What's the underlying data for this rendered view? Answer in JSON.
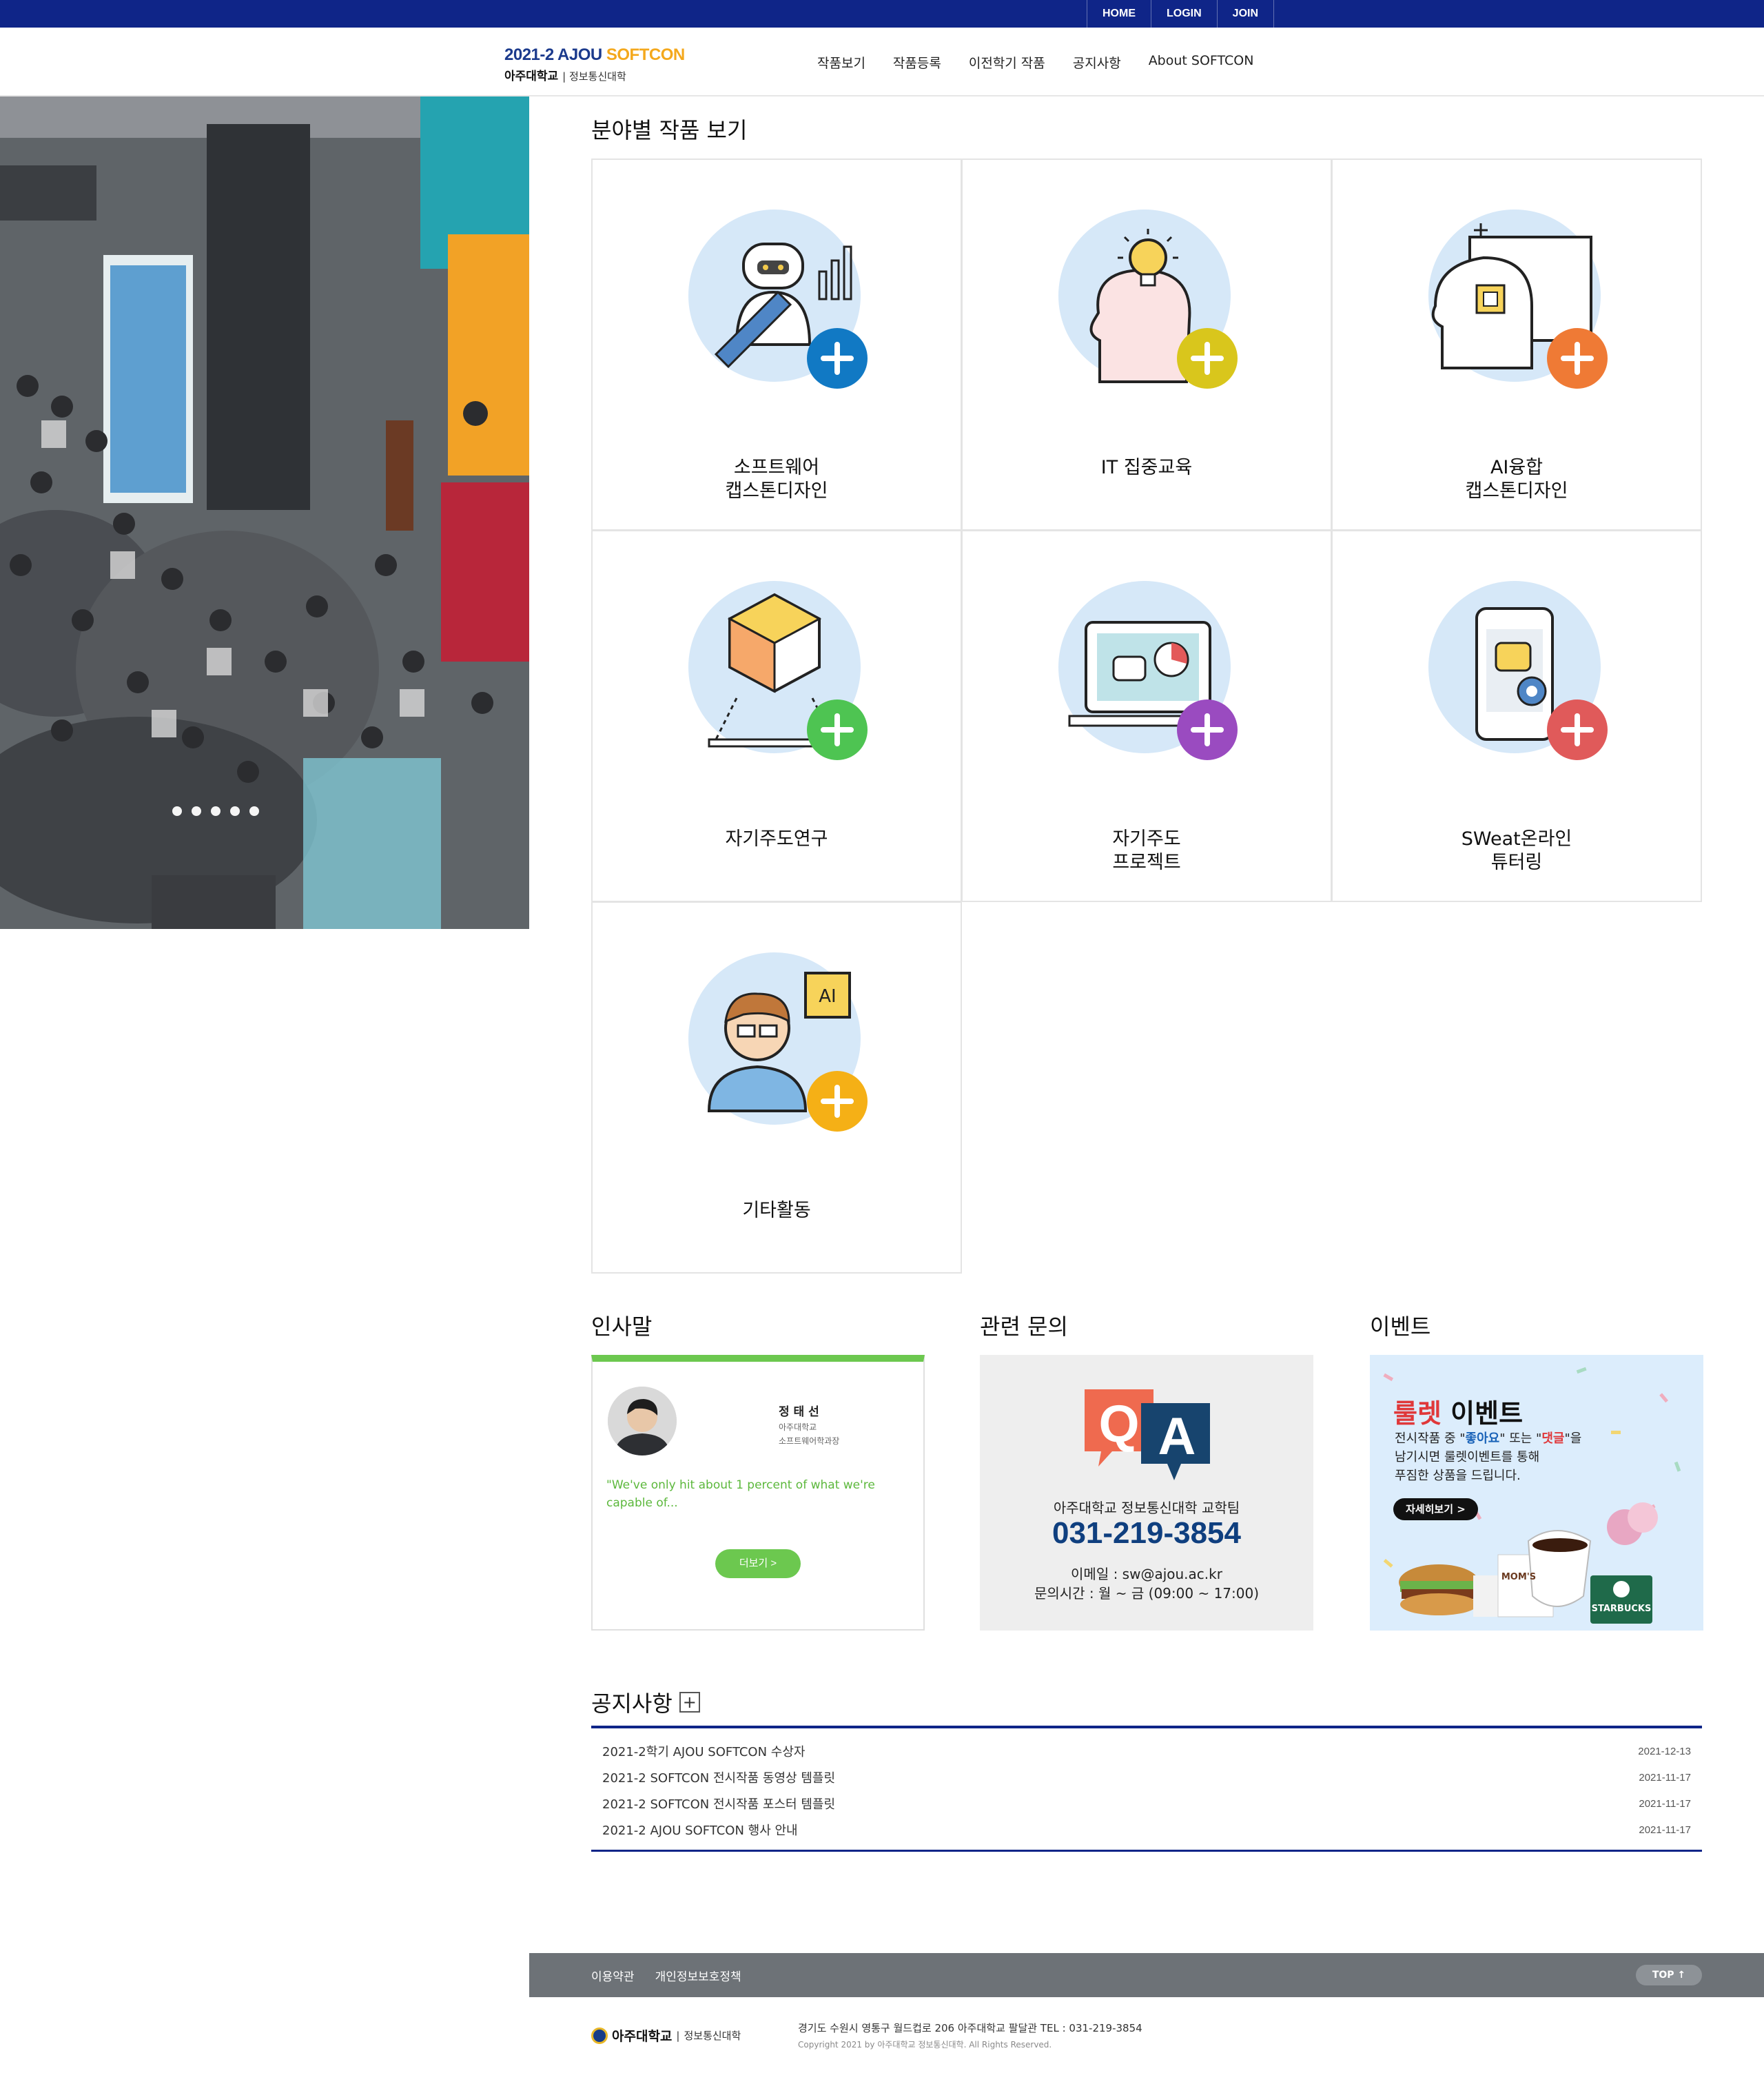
{
  "util_nav": [
    "HOME",
    "LOGIN",
    "JOIN"
  ],
  "logo": {
    "line1_blue": "2021-2 AJOU",
    "line1_gold": "SOFTCON",
    "line2_main": "아주대학교",
    "line2_sub": "정보통신대학"
  },
  "gnb": [
    "작품보기",
    "작품등록",
    "이전학기 작품",
    "공지사항",
    "About SOFTCON"
  ],
  "categories_title": "분야별 작품 보기",
  "categories": [
    {
      "label": "소프트웨어\n캡스톤디자인",
      "accent": "#1179c4"
    },
    {
      "label": "IT 집중교육",
      "accent": "#d9c61c"
    },
    {
      "label": "AI융합\n캡스톤디자인",
      "accent": "#ef7a35"
    },
    {
      "label": "자기주도연구",
      "accent": "#4ec452"
    },
    {
      "label": "자기주도\n프로젝트",
      "accent": "#9a4bc0"
    },
    {
      "label": "SWeat온라인\n튜터링",
      "accent": "#e05a5a"
    },
    {
      "label": "기타활동",
      "accent": "#f5b016"
    }
  ],
  "greeting": {
    "title": "인사말",
    "name": "정 태 선",
    "aff1": "아주대학교",
    "aff2": "소프트웨어학과장",
    "quote": "\"We've only hit about 1 percent of what we're capable of...",
    "more": "더보기 >"
  },
  "inquiry": {
    "title": "관련 문의",
    "team": "아주대학교 정보통신대학 교학팀",
    "phone": "031-219-3854",
    "email": "이메일 : sw@ajou.ac.kr",
    "hours": "문의시간 : 월 ~ 금 (09:00 ~ 17:00)"
  },
  "event": {
    "title": "이벤트",
    "headline_red": "룰렛",
    "headline_black": "이벤트",
    "desc_1": "전시작품 중 \"",
    "desc_like": "좋아요",
    "desc_2": "\" 또는 \"",
    "desc_comment": "댓글",
    "desc_3": "\"을",
    "desc_line2": "남기시면 룰렛이벤트를 통해",
    "desc_line3": "푸짐한 상품을 드립니다.",
    "button": "자세히보기 >",
    "cup_label": "STARBUCKS",
    "box_label": "MOM'S"
  },
  "notice": {
    "title": "공지사항",
    "plus": "+",
    "items": [
      {
        "title": "2021-2학기 AJOU SOFTCON 수상자",
        "date": "2021-12-13"
      },
      {
        "title": "2021-2 SOFTCON 전시작품 동영상 템플릿",
        "date": "2021-11-17"
      },
      {
        "title": "2021-2 SOFTCON 전시작품 포스터 템플릿",
        "date": "2021-11-17"
      },
      {
        "title": "2021-2 AJOU SOFTCON 행사 안내",
        "date": "2021-11-17"
      }
    ]
  },
  "footer": {
    "links": [
      "이용약관",
      "개인정보보호정책"
    ],
    "top": "TOP ↑",
    "logo_main": "아주대학교",
    "logo_sub": "정보통신대학",
    "address": "경기도 수원시 영통구 월드컵로 206 아주대학교 팔달관 TEL : 031-219-3854",
    "copyright": "Copyright 2021 by 아주대학교 정보통신대학. All Rights Reserved."
  },
  "slider_dot_count": 5
}
